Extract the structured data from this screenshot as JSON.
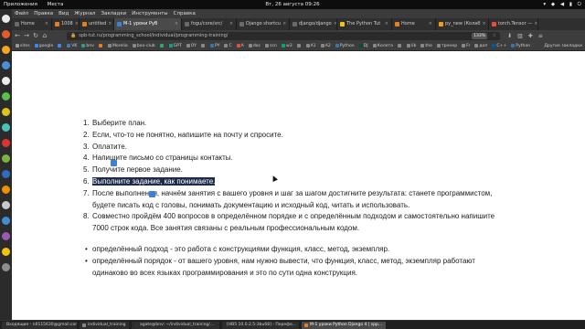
{
  "system_bar": {
    "apps": "Приложения",
    "places": "Места",
    "clock": "Вт, 26 августа 09:26",
    "status_icons": [
      "en",
      "ru",
      "wifi",
      "vol",
      "bat",
      "pwr"
    ]
  },
  "dock": {
    "items": [
      {
        "name": "dock-item",
        "color": "#e8e8e8"
      },
      {
        "name": "dock-item",
        "color": "#e35b2a"
      },
      {
        "name": "dock-item",
        "color": "#f5a623"
      },
      {
        "name": "dock-item",
        "color": "#4a90d9"
      },
      {
        "name": "dock-item",
        "color": "#ececec"
      },
      {
        "name": "dock-item",
        "color": "#5bbf4b"
      },
      {
        "name": "dock-item",
        "color": "#e0c31a"
      },
      {
        "name": "dock-item",
        "color": "#4bc2b8"
      },
      {
        "name": "dock-item",
        "color": "#d33"
      },
      {
        "name": "dock-item",
        "color": "#7ab33d"
      },
      {
        "name": "dock-item",
        "color": "#2d6cc0"
      },
      {
        "name": "dock-item",
        "color": "#ef8f00"
      },
      {
        "name": "dock-item",
        "color": "#c9c9c9"
      },
      {
        "name": "dock-item",
        "color": "#3f8fd2"
      },
      {
        "name": "dock-item",
        "color": "#9b59b6"
      },
      {
        "name": "dock-item",
        "color": "#f1c40f"
      },
      {
        "name": "dock-item",
        "color": "#8d8d8d"
      }
    ]
  },
  "menu": [
    "Файл",
    "Правка",
    "Вид",
    "Журнал",
    "Закладки",
    "Инструменты",
    "Справка"
  ],
  "tabs": [
    {
      "label": "Home",
      "color": "#6a6a6a",
      "active": false
    },
    {
      "label": "1008",
      "color": "#e67e22",
      "active": false
    },
    {
      "label": "untitled",
      "color": "#e67e22",
      "active": false
    },
    {
      "label": "M-1 уроки PyB",
      "color": "#3b82d6",
      "active": true
    },
    {
      "label": "fogu/core/src/",
      "color": "#6a6a6a",
      "active": false
    },
    {
      "label": "Django shortcu",
      "color": "#6a6a6a",
      "active": false
    },
    {
      "label": "django/django",
      "color": "#6a6a6a",
      "active": false
    },
    {
      "label": "The Python Tut",
      "color": "#f1c40f",
      "active": false
    },
    {
      "label": "Home",
      "color": "#e67e22",
      "active": false
    },
    {
      "label": "py_new (Колаб",
      "color": "#f39c12",
      "active": false
    },
    {
      "label": "torch.Tensor —",
      "color": "#e74c3c",
      "active": false
    }
  ],
  "nav": {
    "url": "spb-tut.ru/programming_school/individual/programming-training/",
    "zoom": "133%"
  },
  "bookmarks": {
    "items": [
      {
        "label": "sites",
        "color": "#999"
      },
      {
        "label": "google",
        "color": "#4285f4"
      },
      {
        "label": "",
        "color": "#4285f4"
      },
      {
        "label": "VK",
        "color": "#4a76a8"
      },
      {
        "label": "bnv",
        "color": "#2a9d8f"
      },
      {
        "label": "",
        "color": "#e67e22"
      },
      {
        "label": "Morelia",
        "color": "#888"
      },
      {
        "label": "boo-club",
        "color": "#888"
      },
      {
        "label": "",
        "color": "#27ae60"
      },
      {
        "label": "GPT",
        "color": "#10a37f"
      },
      {
        "label": "OY",
        "color": "#888"
      },
      {
        "label": "",
        "color": "#888"
      },
      {
        "label": "PY",
        "color": "#3776ab"
      },
      {
        "label": "C",
        "color": "#888"
      },
      {
        "label": "A",
        "color": "#e74c3c"
      },
      {
        "label": "doc",
        "color": "#888"
      },
      {
        "label": "scn",
        "color": "#888"
      },
      {
        "label": "w3",
        "color": "#04aa6d"
      },
      {
        "label": "",
        "color": "#888"
      },
      {
        "label": "A1",
        "color": "#888"
      },
      {
        "label": "A2",
        "color": "#888"
      },
      {
        "label": "Python",
        "color": "#3776ab"
      },
      {
        "label": "DJ",
        "color": "#0c4b33"
      },
      {
        "label": "Колета",
        "color": "#888"
      },
      {
        "label": "",
        "color": "#888"
      },
      {
        "label": "lib",
        "color": "#888"
      },
      {
        "label": "the",
        "color": "#888"
      },
      {
        "label": "тренер",
        "color": "#888"
      },
      {
        "label": "Fr",
        "color": "#888"
      },
      {
        "label": "доп",
        "color": "#888"
      },
      {
        "label": "C++",
        "color": "#00599c"
      },
      {
        "label": "Python",
        "color": "#3776ab"
      }
    ],
    "more": "Другие закладки"
  },
  "content": {
    "steps": [
      {
        "num": "1.",
        "text": "Выберите план."
      },
      {
        "num": "2.",
        "text": "Если, что-то не понятно, напишите на почту и спросите."
      },
      {
        "num": "3.",
        "text": "Оплатите."
      },
      {
        "num": "4.",
        "text": "Напишите письмо со страницы контакты."
      },
      {
        "num": "5.",
        "text": "Получите первое задание."
      },
      {
        "num": "6.",
        "text": "Выполните задание, как понимаете."
      },
      {
        "num": "7.",
        "text": "После выполнения, начнём занятия с вашего уровня и шаг за шагом достигните результата: станете программистом, будете писать код с головы, понимать документацию и исходный код, читать и использовать."
      },
      {
        "num": "8.",
        "text": "Совместно пройдём 400 вопросов в определённом порядке и с определённым подходом и самостоятельно напишите 7000 строк кода. Все занятия связаны с реальным профессиональным кодом."
      }
    ],
    "bullets": [
      {
        "text": "определённый подход - это работа с конструкциями функция, класс, метод, экземпляр."
      },
      {
        "text": "определённый порядок - от вашего уровня, нам нужно вывести, что функция, класс, метод, экземпляр работают одинаково во всех языках программирования и это по сути одна конструкция."
      }
    ]
  },
  "taskbar": [
    {
      "label": "Входящие - n0115630@gmail.com -",
      "color": "#e67e22",
      "active": false
    },
    {
      "label": "individual_training",
      "color": "#888",
      "active": false
    },
    {
      "label": "agate@bnv: ~/individual_training/...",
      "color": "#333",
      "active": false
    },
    {
      "label": "[HB5 10.0.2.5-3bu68] - Перефо...",
      "color": "#888",
      "active": false
    },
    {
      "label": "M-1 уроки Python Django 4 | spp...",
      "color": "#e67e22",
      "active": true
    }
  ]
}
